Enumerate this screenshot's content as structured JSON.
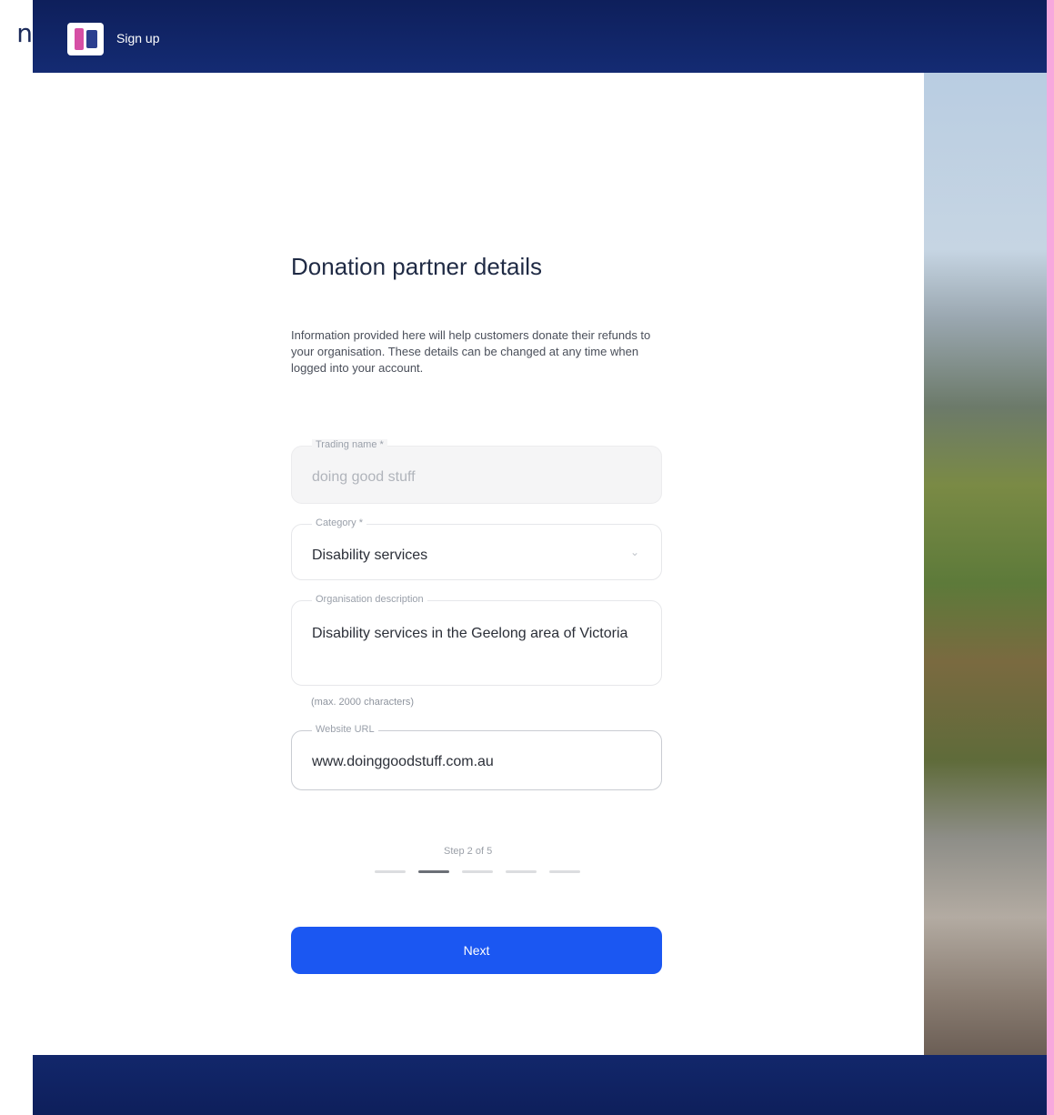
{
  "edge_text": "n",
  "header": {
    "title": "Sign up"
  },
  "form": {
    "heading": "Donation partner details",
    "intro": "Information provided here will help customers donate their refunds to your organisation. These details can be changed at any time when logged into your account.",
    "fields": {
      "trading_name": {
        "label": "Trading name *",
        "value": "doing good stuff"
      },
      "category": {
        "label": "Category *",
        "value": "Disability services"
      },
      "description": {
        "label": "Organisation description",
        "value": "Disability services in the Geelong area of Victoria"
      },
      "description_helper": "(max. 2000 characters)",
      "website": {
        "label": "Website URL",
        "value": "www.doinggoodstuff.com.au"
      }
    },
    "step": {
      "label": "Step 2 of 5",
      "current": 2,
      "total": 5
    },
    "next_label": "Next"
  },
  "colors": {
    "header_bg": "#0e1f5b",
    "accent": "#1b57f2",
    "pink_border": "#f7a8dd"
  }
}
